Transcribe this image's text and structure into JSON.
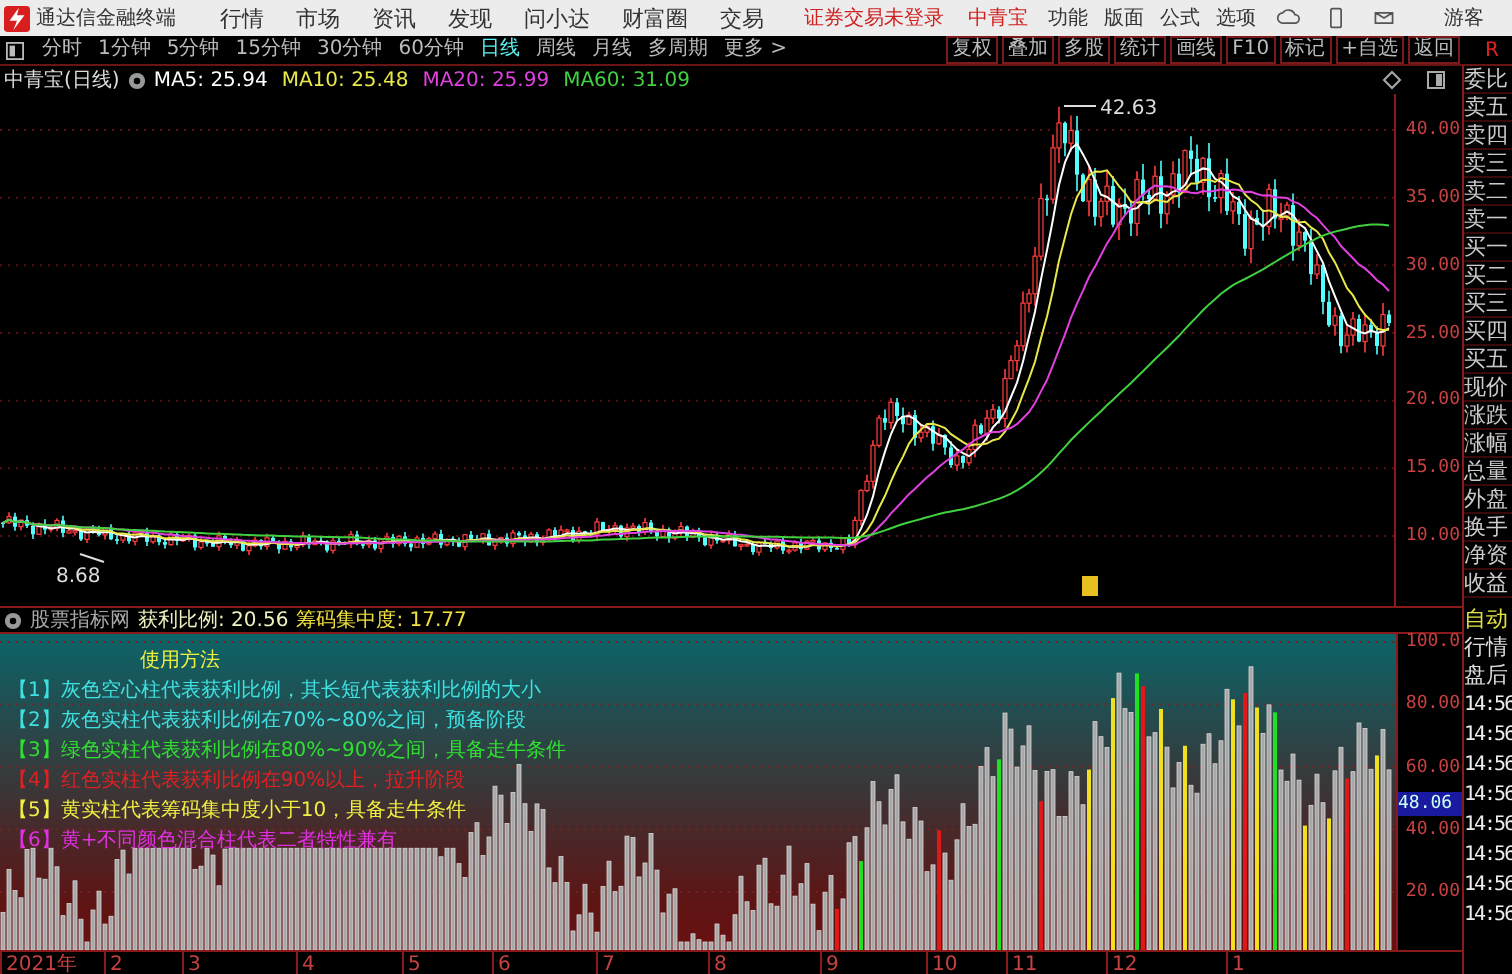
{
  "app_menu": {
    "title": "通达信金融终端",
    "items": [
      "行情",
      "市场",
      "资讯",
      "发现",
      "问小达",
      "财富圈",
      "交易"
    ],
    "login_status": "证券交易未登录",
    "stock": "中青宝",
    "tools": [
      "功能",
      "版面",
      "公式",
      "选项"
    ],
    "user": "游客"
  },
  "period_tabs": [
    {
      "label": "分时",
      "selected": false
    },
    {
      "label": "1分钟",
      "selected": false
    },
    {
      "label": "5分钟",
      "selected": false
    },
    {
      "label": "15分钟",
      "selected": false
    },
    {
      "label": "30分钟",
      "selected": false
    },
    {
      "label": "60分钟",
      "selected": false
    },
    {
      "label": "日线",
      "selected": true
    },
    {
      "label": "周线",
      "selected": false
    },
    {
      "label": "月线",
      "selected": false
    },
    {
      "label": "多周期",
      "selected": false
    },
    {
      "label": "更多 >",
      "selected": false
    }
  ],
  "tool_buttons": [
    "复权",
    "叠加",
    "多股",
    "统计",
    "画线",
    "F10",
    "标记",
    "+自选",
    "返回"
  ],
  "side_mark": "R",
  "chart": {
    "title": "中青宝(日线)",
    "ma": [
      {
        "label": "MA5: 25.94",
        "color": "#ffffff"
      },
      {
        "label": "MA10: 25.48",
        "color": "#e8e84a"
      },
      {
        "label": "MA20: 25.99",
        "color": "#e040e0"
      },
      {
        "label": "MA60: 31.09",
        "color": "#40d040"
      }
    ],
    "price_ticks": [
      "40.00",
      "35.00",
      "30.00",
      "25.00",
      "20.00",
      "15.00",
      "10.00"
    ],
    "high_label": "42.63",
    "low_label": "8.68"
  },
  "indicator": {
    "name": "股票指标网",
    "profit": "获利比例: 20.56",
    "concentration": "筹码集中度: 17.77",
    "legend_title": "使用方法",
    "legend": [
      {
        "text": "【1】灰色空心柱代表获利比例，其长短代表获利比例的大小",
        "color": "#40e0e0"
      },
      {
        "text": "【2】灰色实柱代表获利比例在70%~80%之间，预备阶段",
        "color": "#40e0e0"
      },
      {
        "text": "【3】绿色实柱代表获利比例在80%~90%之间，具备走牛条件",
        "color": "#30e030"
      },
      {
        "text": "【4】红色实柱代表获利比例在90%以上，拉升阶段",
        "color": "#e02020"
      },
      {
        "text": "【5】黄实柱代表筹码集中度小于10，具备走牛条件",
        "color": "#f0f040"
      },
      {
        "text": "【6】黄+不同颜色混合柱代表二者特性兼有",
        "color": "#e030e0"
      }
    ],
    "ticks": [
      "100.0",
      "80.00",
      "60.00",
      "40.00",
      "20.00"
    ],
    "current": "48.06"
  },
  "dates": [
    "2021年",
    "2",
    "3",
    "4",
    "5",
    "6",
    "7",
    "8",
    "9",
    "10",
    "11",
    "12",
    "1"
  ],
  "sidebar": {
    "quote_labels": [
      "委比",
      "卖五",
      "卖四",
      "卖三",
      "卖二",
      "卖一",
      "买一",
      "买二",
      "买三",
      "买四",
      "买五",
      "现价",
      "涨跌",
      "涨幅",
      "总量",
      "外盘",
      "换手",
      "净资",
      "收益"
    ],
    "auto": "自动",
    "tabs": [
      "行情",
      "盘后"
    ],
    "times": [
      "14:56",
      "14:56",
      "14:56",
      "14:56",
      "14:56",
      "14:56",
      "14:56",
      "14:56"
    ]
  }
}
